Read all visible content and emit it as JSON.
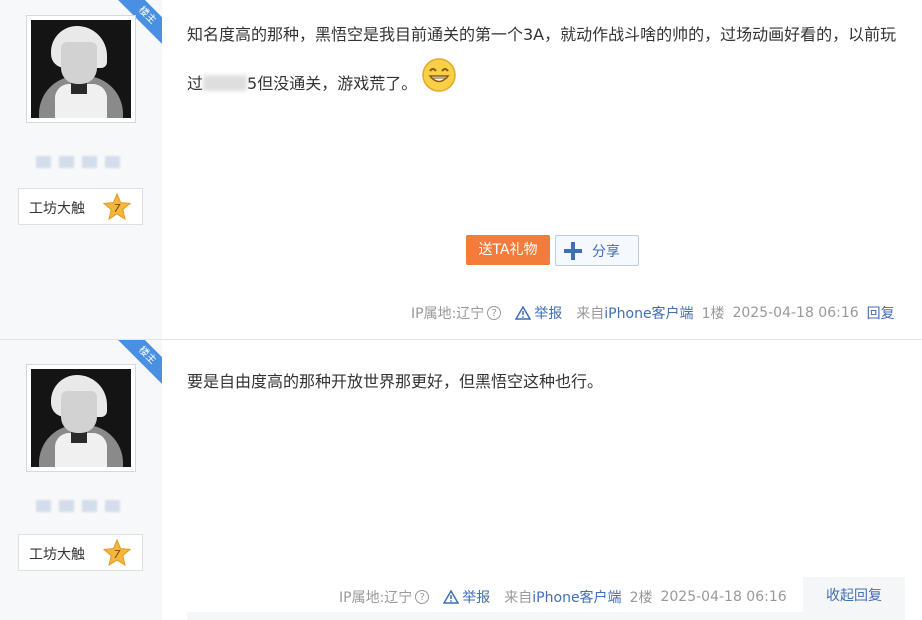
{
  "posts": [
    {
      "corner_label": "楼主",
      "badge_label": "工坊大触",
      "level": "7",
      "content_part1": "知名度高的那种，黑悟空是我目前通关的第一个3A，就动作战斗啥的帅的，过场动画好看的，以前玩过",
      "content_part2": "5但没通关，游戏荒了。",
      "emoji_icon": "grinning-face-icon",
      "gift_label": "送TA礼物",
      "share_label": "分享",
      "ip_location": "IP属地:辽宁",
      "report_label": "举报",
      "source_prefix": "来自",
      "source_client": "iPhone客户端",
      "floor": "1楼",
      "timestamp": "2025-04-18 06:16",
      "reply_label": "回复"
    },
    {
      "corner_label": "楼主",
      "badge_label": "工坊大触",
      "level": "7",
      "content": "要是自由度高的那种开放世界那更好，但黑悟空这种也行。",
      "ip_location": "IP属地:辽宁",
      "report_label": "举报",
      "source_prefix": "来自",
      "source_client": "iPhone客户端",
      "floor": "2楼",
      "timestamp": "2025-04-18 06:16",
      "collapse_label": "收起回复"
    }
  ],
  "colors": {
    "accent_blue": "#3f6fb5",
    "corner_blue": "#4a90e2",
    "gift_orange": "#f37b3b",
    "level_gold": "#f3b63f"
  }
}
